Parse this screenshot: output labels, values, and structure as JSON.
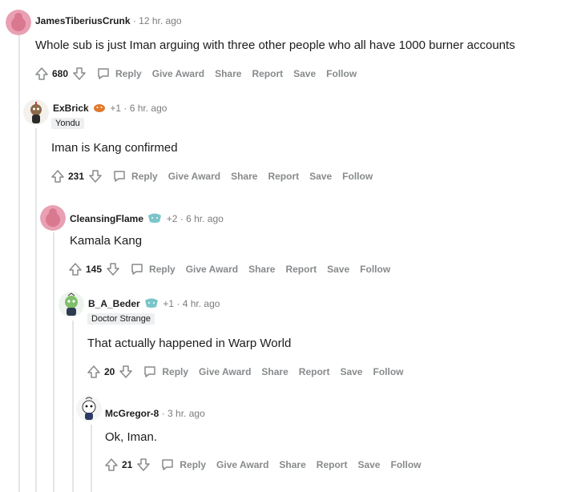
{
  "actions": {
    "reply": "Reply",
    "give_award": "Give Award",
    "share": "Share",
    "report": "Report",
    "save": "Save",
    "follow": "Follow"
  },
  "comments": [
    {
      "author": "JamesTiberiusCrunk",
      "score_tag": "",
      "time": "· 12 hr. ago",
      "flair": "",
      "body": "Whole sub is just Iman arguing with three other people who all have 1000 burner accounts",
      "votes": "680"
    },
    {
      "author": "ExBrick",
      "score_tag": "+1",
      "time": "· 6 hr. ago",
      "flair": "Yondu",
      "body": "Iman is Kang confirmed",
      "votes": "231"
    },
    {
      "author": "CleansingFlame",
      "score_tag": "+2",
      "time": "· 6 hr. ago",
      "flair": "",
      "body": "Kamala Kang",
      "votes": "145"
    },
    {
      "author": "B_A_Beder",
      "score_tag": "+1",
      "time": "· 4 hr. ago",
      "flair": "Doctor Strange",
      "body": "That actually happened in Warp World",
      "votes": "20"
    },
    {
      "author": "McGregor-8",
      "score_tag": "",
      "time": "· 3 hr. ago",
      "flair": "",
      "body": "Ok, Iman.",
      "votes": "21"
    }
  ],
  "colors": {
    "meta_gray": "#7c7c7c",
    "action_gray": "#878a8c",
    "thread_line": "#e3e5e8",
    "flair_bg": "#edeff1",
    "avatar_pink": "#e9a0b3"
  },
  "icons": [
    "upvote-icon",
    "downvote-icon",
    "reply-bubble-icon",
    "award-emoji-icon",
    "snoo-avatar-icon"
  ]
}
